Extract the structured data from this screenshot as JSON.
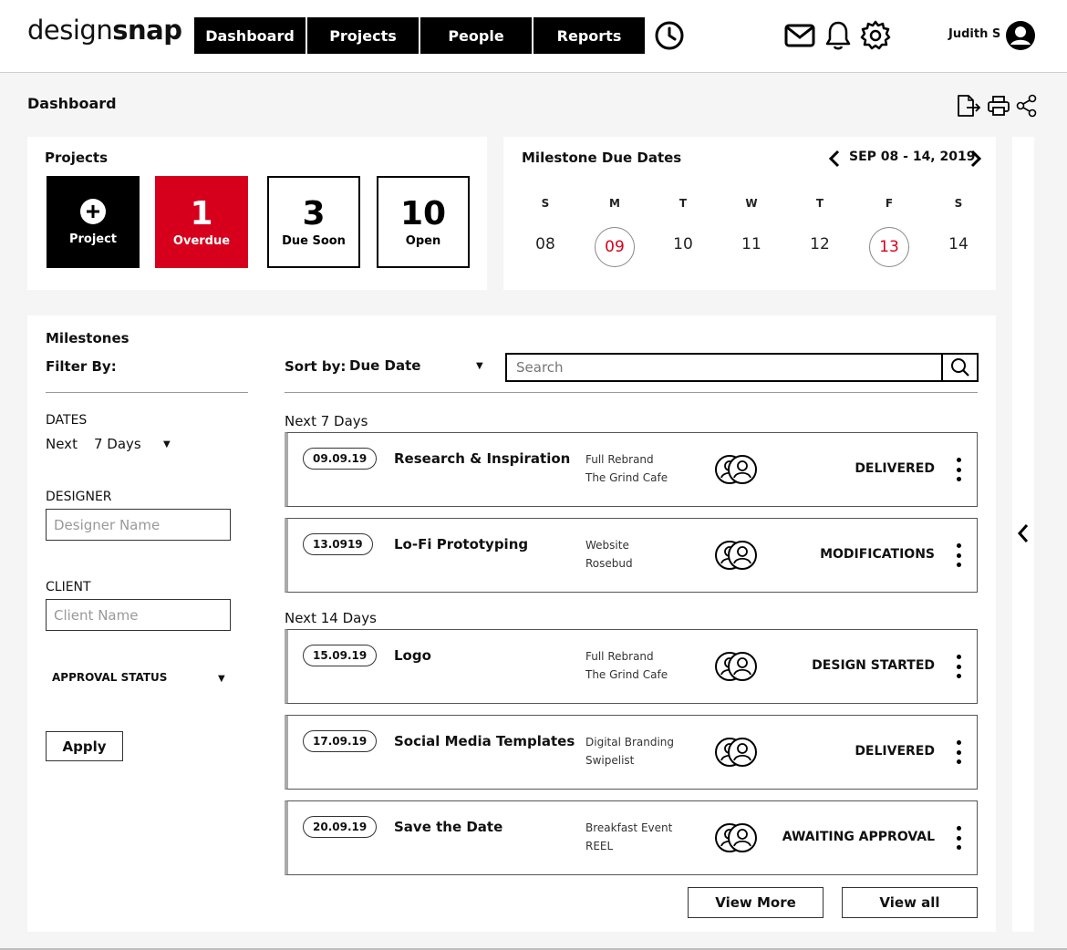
{
  "header": {
    "logo_light": "design",
    "logo_bold": "snap",
    "nav": [
      "Dashboard",
      "Projects",
      "People",
      "Reports"
    ],
    "username": "Judith S"
  },
  "page": {
    "title": "Dashboard"
  },
  "projects": {
    "title": "Projects",
    "new_label": "Project",
    "overdue": {
      "count": "1",
      "label": "Overdue"
    },
    "due_soon": {
      "count": "3",
      "label": "Due Soon"
    },
    "open": {
      "count": "10",
      "label": "Open"
    }
  },
  "calendar": {
    "title": "Milestone Due Dates",
    "range": "SEP 08 - 14, 2019",
    "days": [
      {
        "letter": "S",
        "date": "08",
        "highlight": false
      },
      {
        "letter": "M",
        "date": "09",
        "highlight": true
      },
      {
        "letter": "T",
        "date": "10",
        "highlight": false
      },
      {
        "letter": "W",
        "date": "11",
        "highlight": false
      },
      {
        "letter": "T",
        "date": "12",
        "highlight": false
      },
      {
        "letter": "F",
        "date": "13",
        "highlight": true
      },
      {
        "letter": "S",
        "date": "14",
        "highlight": false
      }
    ]
  },
  "milestones": {
    "title": "Milestones",
    "filter_by": "Filter By:",
    "dates_label": "DATES",
    "dates_prefix": "Next",
    "dates_value": "7 Days",
    "designer_label": "DESIGNER",
    "designer_placeholder": "Designer Name",
    "client_label": "CLIENT",
    "client_placeholder": "Client Name",
    "approval_label": "APPROVAL STATUS",
    "apply_label": "Apply",
    "sort_label": "Sort by:",
    "sort_value": "Due Date",
    "search_placeholder": "Search",
    "group1": "Next 7 Days",
    "group2": "Next 14 Days",
    "items": [
      {
        "date": "09.09.19",
        "title": "Research & Inspiration",
        "line1": "Full Rebrand",
        "line2": "The Grind Cafe",
        "status": "DELIVERED"
      },
      {
        "date": "13.0919",
        "title": "Lo-Fi Prototyping",
        "line1": "Website",
        "line2": "Rosebud",
        "status": "MODIFICATIONS"
      },
      {
        "date": "15.09.19",
        "title": "Logo",
        "line1": "Full Rebrand",
        "line2": "The Grind Cafe",
        "status": "DESIGN STARTED"
      },
      {
        "date": "17.09.19",
        "title": "Social Media Templates",
        "line1": "Digital Branding",
        "line2": "Swipelist",
        "status": "DELIVERED"
      },
      {
        "date": "20.09.19",
        "title": "Save the Date",
        "line1": "Breakfast Event",
        "line2": "REEL",
        "status": "AWAITING APPROVAL"
      }
    ],
    "view_more": "View More",
    "view_all": "View all"
  },
  "colors": {
    "accent_red": "#d6001c",
    "black": "#000000",
    "panel": "#ffffff",
    "bg": "#f5f5f5"
  }
}
